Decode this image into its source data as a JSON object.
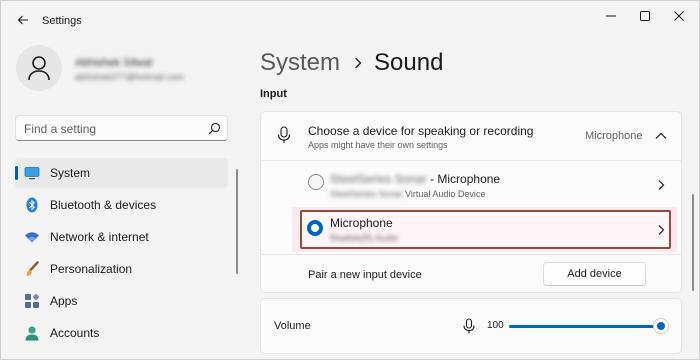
{
  "window": {
    "title": "Settings"
  },
  "profile": {
    "name": "Abhishek Silwal",
    "email": "abhishek077@hotmail.com"
  },
  "search": {
    "placeholder": "Find a setting"
  },
  "nav": {
    "items": [
      {
        "label": "System",
        "icon": "monitor-icon",
        "active": true
      },
      {
        "label": "Bluetooth & devices",
        "icon": "bluetooth-icon",
        "active": false
      },
      {
        "label": "Network & internet",
        "icon": "wifi-icon",
        "active": false
      },
      {
        "label": "Personalization",
        "icon": "brush-icon",
        "active": false
      },
      {
        "label": "Apps",
        "icon": "apps-icon",
        "active": false
      },
      {
        "label": "Accounts",
        "icon": "person-icon",
        "active": false
      }
    ]
  },
  "breadcrumb": {
    "parent": "System",
    "current": "Sound"
  },
  "input_section": {
    "title": "Input",
    "choose_title": "Choose a device for speaking or recording",
    "choose_subtitle": "Apps might have their own settings",
    "selected_device": "Microphone",
    "devices": [
      {
        "name_blurred": "SteelSeries Sonar",
        "name_suffix": " - Microphone",
        "subtitle_blurred": "SteelSeries Sonar",
        "subtitle_suffix": " Virtual Audio Device",
        "selected": false
      },
      {
        "name": "Microphone",
        "subtitle_blurred": "Realtek(R) Audio",
        "selected": true
      }
    ],
    "pair_label": "Pair a new input device",
    "add_button": "Add device"
  },
  "volume": {
    "label": "Volume",
    "value": "100",
    "level": 1.0
  },
  "colors": {
    "accent": "#0067c0",
    "highlight_border": "#8c4e3a"
  }
}
